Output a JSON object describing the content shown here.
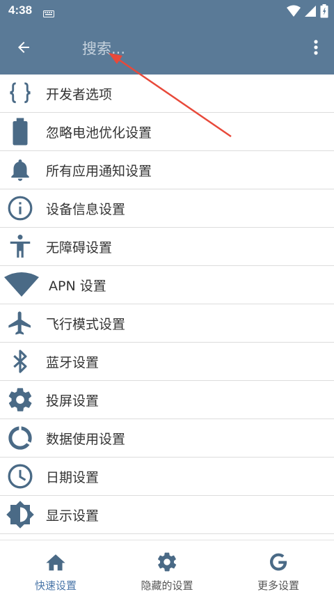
{
  "status_bar": {
    "time": "4:38"
  },
  "app_bar": {
    "search_placeholder": "搜索..."
  },
  "colors": {
    "primary": "#5a7a97",
    "icon": "#4a6a86",
    "accent_nav": "#4a76a8",
    "annotation_arrow": "#e8493a"
  },
  "list": {
    "items": [
      {
        "label": "开发者选项",
        "icon": "braces-icon"
      },
      {
        "label": "忽略电池优化设置",
        "icon": "battery-icon"
      },
      {
        "label": "所有应用通知设置",
        "icon": "bell-icon"
      },
      {
        "label": "设备信息设置",
        "icon": "info-icon"
      },
      {
        "label": "无障碍设置",
        "icon": "accessibility-icon"
      },
      {
        "label": "APN 设置",
        "icon": "wifi-icon"
      },
      {
        "label": "飞行模式设置",
        "icon": "airplane-icon"
      },
      {
        "label": "蓝牙设置",
        "icon": "bluetooth-icon"
      },
      {
        "label": "投屏设置",
        "icon": "gear-icon"
      },
      {
        "label": "数据使用设置",
        "icon": "data-usage-icon"
      },
      {
        "label": "日期设置",
        "icon": "clock-icon"
      },
      {
        "label": "显示设置",
        "icon": "brightness-icon"
      }
    ]
  },
  "bottom_nav": {
    "items": [
      {
        "label": "快速设置",
        "icon": "home-icon"
      },
      {
        "label": "隐藏的设置",
        "icon": "gear-icon"
      },
      {
        "label": "更多设置",
        "icon": "google-icon"
      }
    ]
  }
}
